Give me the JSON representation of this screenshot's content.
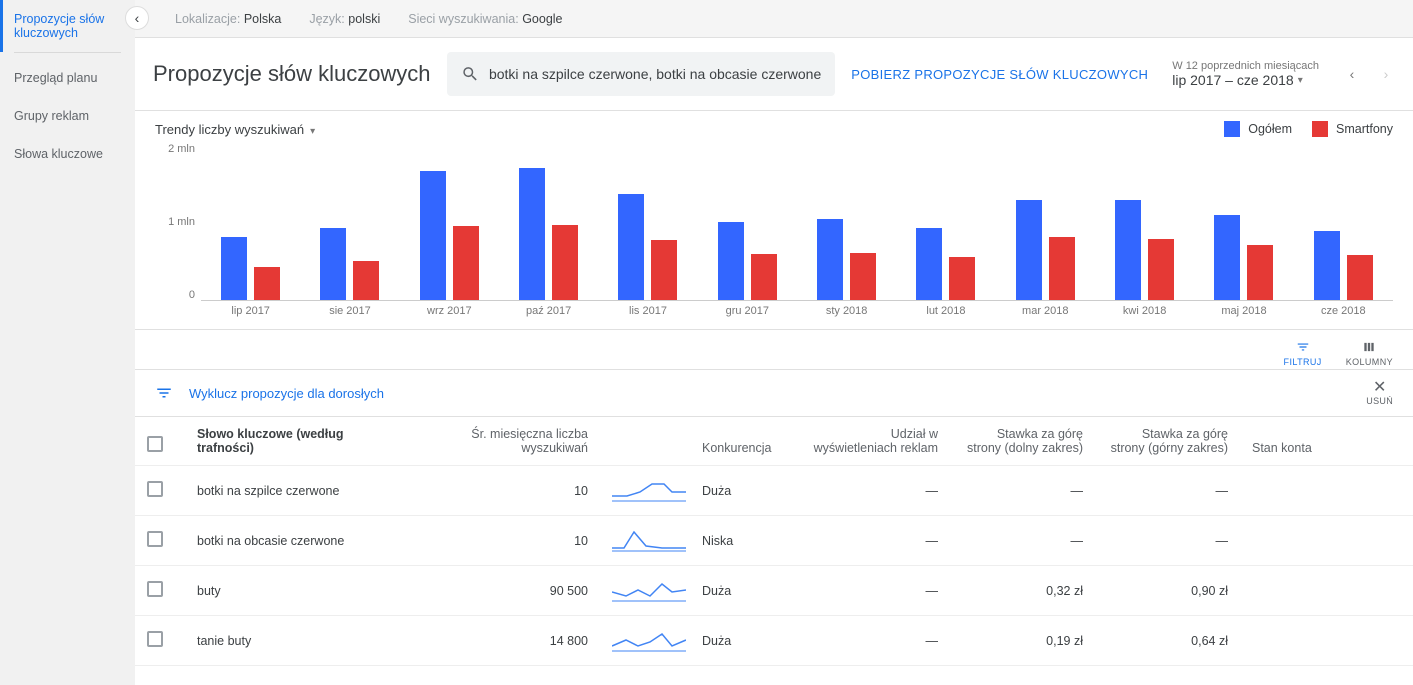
{
  "sidebar": {
    "items": [
      {
        "label": "Propozycje słów kluczowych",
        "active": true
      },
      {
        "label": "Przegląd planu",
        "active": false
      },
      {
        "label": "Grupy reklam",
        "active": false
      },
      {
        "label": "Słowa kluczowe",
        "active": false
      }
    ]
  },
  "topbar": {
    "loc_label": "Lokalizacje:",
    "loc_value": "Polska",
    "lang_label": "Język:",
    "lang_value": "polski",
    "net_label": "Sieci wyszukiwania:",
    "net_value": "Google"
  },
  "header": {
    "title": "Propozycje słów kluczowych",
    "search_value": "botki na szpilce czerwone, botki na obcasie czerwone",
    "cta": "POBIERZ PROPOZYCJE SŁÓW KLUCZOWYCH",
    "date_sub": "W 12 poprzednich miesiącach",
    "date_main": "lip 2017 – cze 2018"
  },
  "chart_header": {
    "trend_label": "Trendy liczby wyszukiwań",
    "legend1": "Ogółem",
    "legend2": "Smartfony",
    "color1": "#3366ff",
    "color2": "#e53935"
  },
  "chart_data": {
    "type": "bar",
    "ylabel": "",
    "ylim": [
      0,
      2000000
    ],
    "y_ticks": [
      "2 mln",
      "1 mln",
      "0"
    ],
    "categories": [
      "lip 2017",
      "sie 2017",
      "wrz 2017",
      "paź 2017",
      "lis 2017",
      "gru 2017",
      "sty 2018",
      "lut 2018",
      "mar 2018",
      "kwi 2018",
      "maj 2018",
      "cze 2018"
    ],
    "series": [
      {
        "name": "Ogółem",
        "values": [
          0.8,
          0.92,
          1.64,
          1.68,
          1.35,
          1.0,
          1.03,
          0.92,
          1.28,
          1.28,
          1.08,
          0.88
        ]
      },
      {
        "name": "Smartfony",
        "values": [
          0.42,
          0.5,
          0.94,
          0.96,
          0.77,
          0.58,
          0.6,
          0.55,
          0.8,
          0.78,
          0.7,
          0.57
        ]
      }
    ],
    "unit_note": "values are in millions (mln)"
  },
  "toolbar": {
    "filter": "FILTRUJ",
    "columns": "KOLUMNY"
  },
  "filter_row": {
    "link": "Wyklucz propozycje dla dorosłych",
    "remove": "USUŃ"
  },
  "table": {
    "headers": {
      "keyword": "Słowo kluczowe (według trafności)",
      "avg": "Śr. miesięczna liczba wyszukiwań",
      "competition": "Konkurencja",
      "share": "Udział w wyświetleniach reklam",
      "low": "Stawka za górę strony (dolny zakres)",
      "high": "Stawka za górę strony (górny zakres)",
      "status": "Stan konta"
    },
    "rows": [
      {
        "kw": "botki na szpilce czerwone",
        "avg": "10",
        "comp": "Duża",
        "share": "—",
        "low": "—",
        "high": "—"
      },
      {
        "kw": "botki na obcasie czerwone",
        "avg": "10",
        "comp": "Niska",
        "share": "—",
        "low": "—",
        "high": "—"
      },
      {
        "kw": "buty",
        "avg": "90 500",
        "comp": "Duża",
        "share": "—",
        "low": "0,32 zł",
        "high": "0,90 zł"
      },
      {
        "kw": "tanie buty",
        "avg": "14 800",
        "comp": "Duża",
        "share": "—",
        "low": "0,19 zł",
        "high": "0,64 zł"
      }
    ]
  }
}
